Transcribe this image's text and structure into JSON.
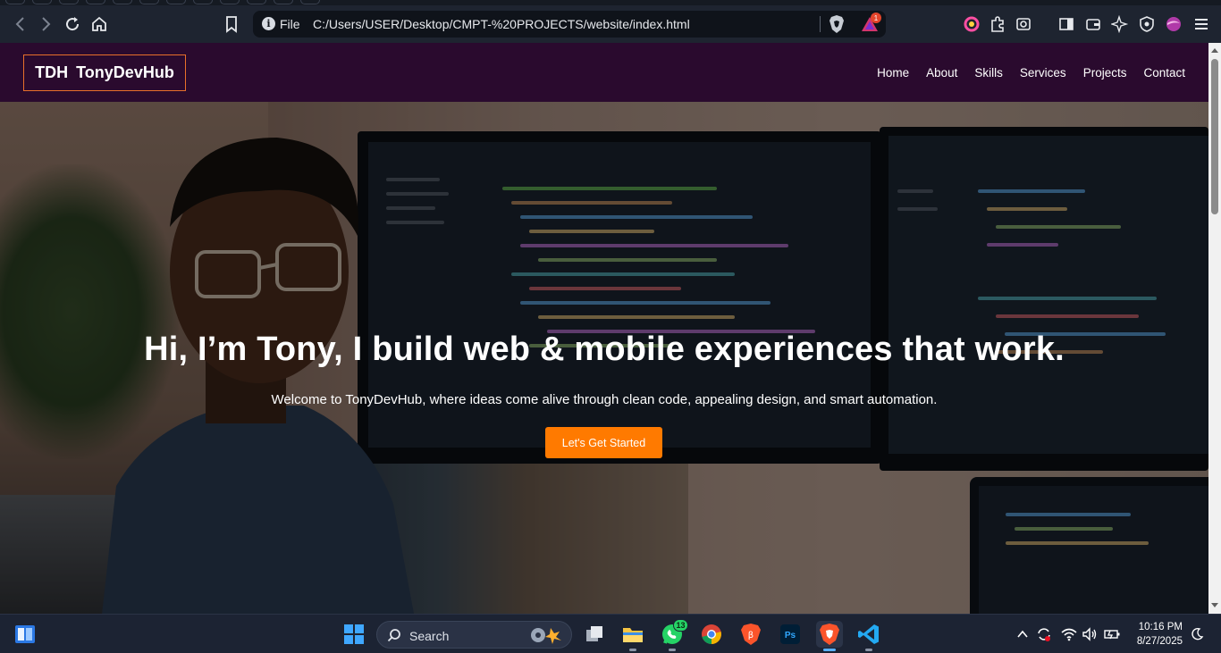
{
  "browser": {
    "address": {
      "scheme_label": "File",
      "url": "C:/Users/USER/Desktop/CMPT-%20PROJECTS/website/index.html"
    },
    "rewards_badge": "1",
    "icons": [
      "back-icon",
      "forward-icon",
      "reload-icon",
      "home-icon",
      "bookmark-icon",
      "info-icon",
      "brave-shields-icon",
      "brave-rewards-icon",
      "extension-color-icon",
      "extensions-icon",
      "screenshot-icon",
      "sidebar-icon",
      "wallet-icon",
      "leo-ai-icon",
      "vpn-icon",
      "profile-icon",
      "menu-icon"
    ]
  },
  "site": {
    "logo": "TDH  TonyDevHub",
    "nav": [
      "Home",
      "About",
      "Skills",
      "Services",
      "Projects",
      "Contact"
    ],
    "hero": {
      "title": "Hi, I’m Tony, I build web & mobile experiences that work.",
      "subtitle": "Welcome to TonyDevHub, where ideas come alive through clean code, appealing design, and smart automation.",
      "cta": "Let's Get Started"
    }
  },
  "taskbar": {
    "search_label": "Search",
    "whatsapp_badge": "13",
    "time": "10:16 PM",
    "date": "8/27/2025",
    "apps": [
      "widgets-icon",
      "start-icon",
      "task-view-icon",
      "file-explorer-icon",
      "whatsapp-icon",
      "chrome-icon",
      "brave-beta-icon",
      "photoshop-icon",
      "brave-icon",
      "vscode-icon"
    ],
    "accent": "#5ab0ff"
  },
  "colors": {
    "nav_bg": "#2a0a2e",
    "logo_border": "#e8702a",
    "cta_bg": "#ff7a00"
  }
}
